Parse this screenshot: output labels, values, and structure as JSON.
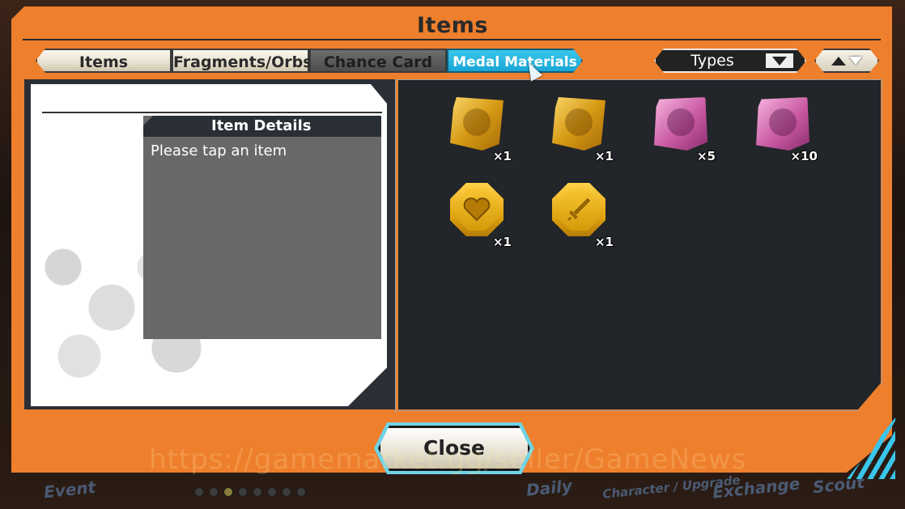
{
  "dialog": {
    "title": "Items",
    "close_label": "Close"
  },
  "tabs": [
    {
      "label": "Items"
    },
    {
      "label": "Fragments/Orbs"
    },
    {
      "label": "Chance Card"
    },
    {
      "label": "Medal Materials",
      "active": true
    }
  ],
  "sort": {
    "label": "Types",
    "icon": "chevron-down-icon",
    "order_icons": [
      "arrow-up-icon",
      "arrow-down-icon"
    ]
  },
  "detail": {
    "header": "Item Details",
    "text": "Please tap an item"
  },
  "medals": [
    {
      "icon": "gold-portrait-medal-icon",
      "qty": "×1"
    },
    {
      "icon": "gold-portrait-medal-icon",
      "qty": "×1"
    },
    {
      "icon": "pink-portrait-medal-icon",
      "qty": "×5"
    },
    {
      "icon": "pink-portrait-medal-icon",
      "qty": "×10"
    },
    {
      "icon": "heart-medal-icon",
      "qty": "×1"
    },
    {
      "icon": "sword-medal-icon",
      "qty": "×1"
    }
  ],
  "background_nav": [
    "Event",
    "Daily",
    "Character / Upgrade",
    "Exchange",
    "Scout"
  ],
  "watermark": "https://gamemarket.gg/seller/GameNews",
  "colors": {
    "frame": "#ee7f2d",
    "active_tab": "#1aa6d6",
    "panel": "#222529",
    "gold": "#e4a612",
    "pink": "#c95aa3"
  }
}
